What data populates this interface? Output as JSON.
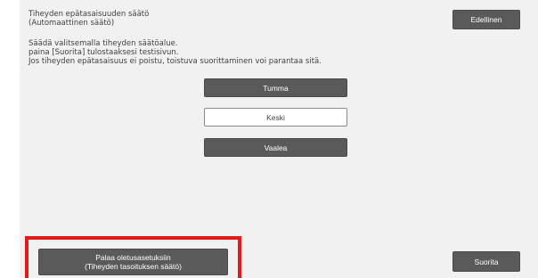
{
  "header": {
    "title": "Tiheyden epätasaisuuden säätö\n(Automaattinen säätö)",
    "back_label": "Edellinen"
  },
  "instructions": {
    "line1": "Säädä valitsemalla tiheyden säätöalue.",
    "line2": "paina [Suorita] tulostaaksesi testisivun.",
    "line3": "Jos tiheyden epätasaisuus ei poistu, toistuva suorittaminen voi parantaa sitä."
  },
  "options": {
    "dark": "Tumma",
    "medium": "Keski",
    "light": "Vaalea",
    "selected": "Keski"
  },
  "footer": {
    "reset_label": "Palaa oletusasetuksiin\n(Tiheyden tasoituksen säätö)",
    "execute_label": "Suorita"
  },
  "colors": {
    "highlight": "#e11a1a",
    "button_dark": "#5a5a5a",
    "panel_bg": "#f1f1f1"
  }
}
